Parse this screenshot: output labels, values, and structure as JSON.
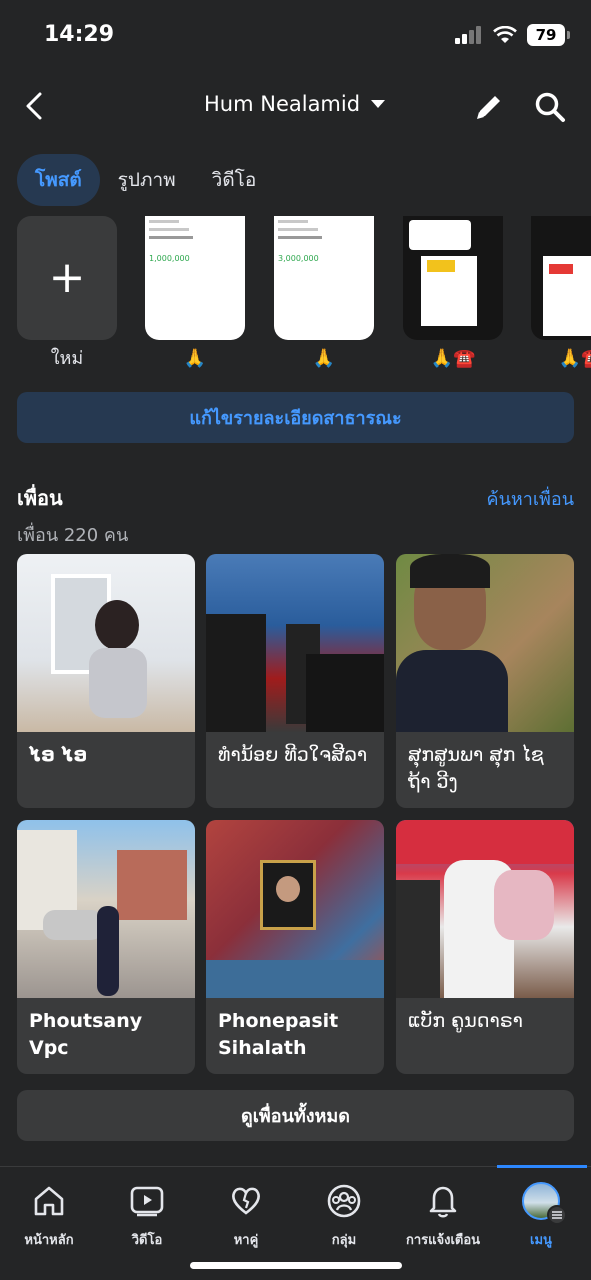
{
  "status": {
    "time": "14:29",
    "battery": "79"
  },
  "header": {
    "title": "Hum Nealamid"
  },
  "tabs": [
    {
      "label": "โพสต์"
    },
    {
      "label": "รูปภาพ"
    },
    {
      "label": "วิดีโอ"
    }
  ],
  "photos": [
    {
      "caption": "ใหม่",
      "kind": "new"
    },
    {
      "caption": "🙏",
      "kind": "doc",
      "amount": "1,000,000"
    },
    {
      "caption": "🙏",
      "kind": "doc",
      "amount": "3,000,000"
    },
    {
      "caption": "🙏☎️",
      "kind": "dark"
    },
    {
      "caption": "🙏☎️",
      "kind": "dark"
    }
  ],
  "edit_public_label": "แก้ไขรายละเอียดสาธารณะ",
  "friends": {
    "title": "เพื่อน",
    "count": "เพื่อน 220 คน",
    "find_link": "ค้นหาเพื่อน",
    "items": [
      {
        "name": "ໄອ ໄອ"
      },
      {
        "name": "ທຳນ້ອຍ ທີວໃຈສີລາ"
      },
      {
        "name": "ສຸກສູນພາ ສຸກ ໄຊຖ້າ ວີງ"
      },
      {
        "name": "Phoutsany Vpc"
      },
      {
        "name": "Phonepasit Sihalath"
      },
      {
        "name": "ແບັກ ຄູນດາຣາ"
      }
    ],
    "see_all": "ดูเพื่อนทั้งหมด"
  },
  "bottom_nav": [
    {
      "label": "หน้าหลัก",
      "icon": "home-icon"
    },
    {
      "label": "วิดีโอ",
      "icon": "video-icon"
    },
    {
      "label": "หาคู่",
      "icon": "dating-heart-icon"
    },
    {
      "label": "กลุ่ม",
      "icon": "groups-icon"
    },
    {
      "label": "การแจ้งเตือน",
      "icon": "bell-icon"
    },
    {
      "label": "เมนู",
      "icon": "menu-avatar-icon"
    }
  ],
  "colors": {
    "accent": "#4599ff",
    "background": "#242526",
    "card": "#3a3b3c"
  }
}
